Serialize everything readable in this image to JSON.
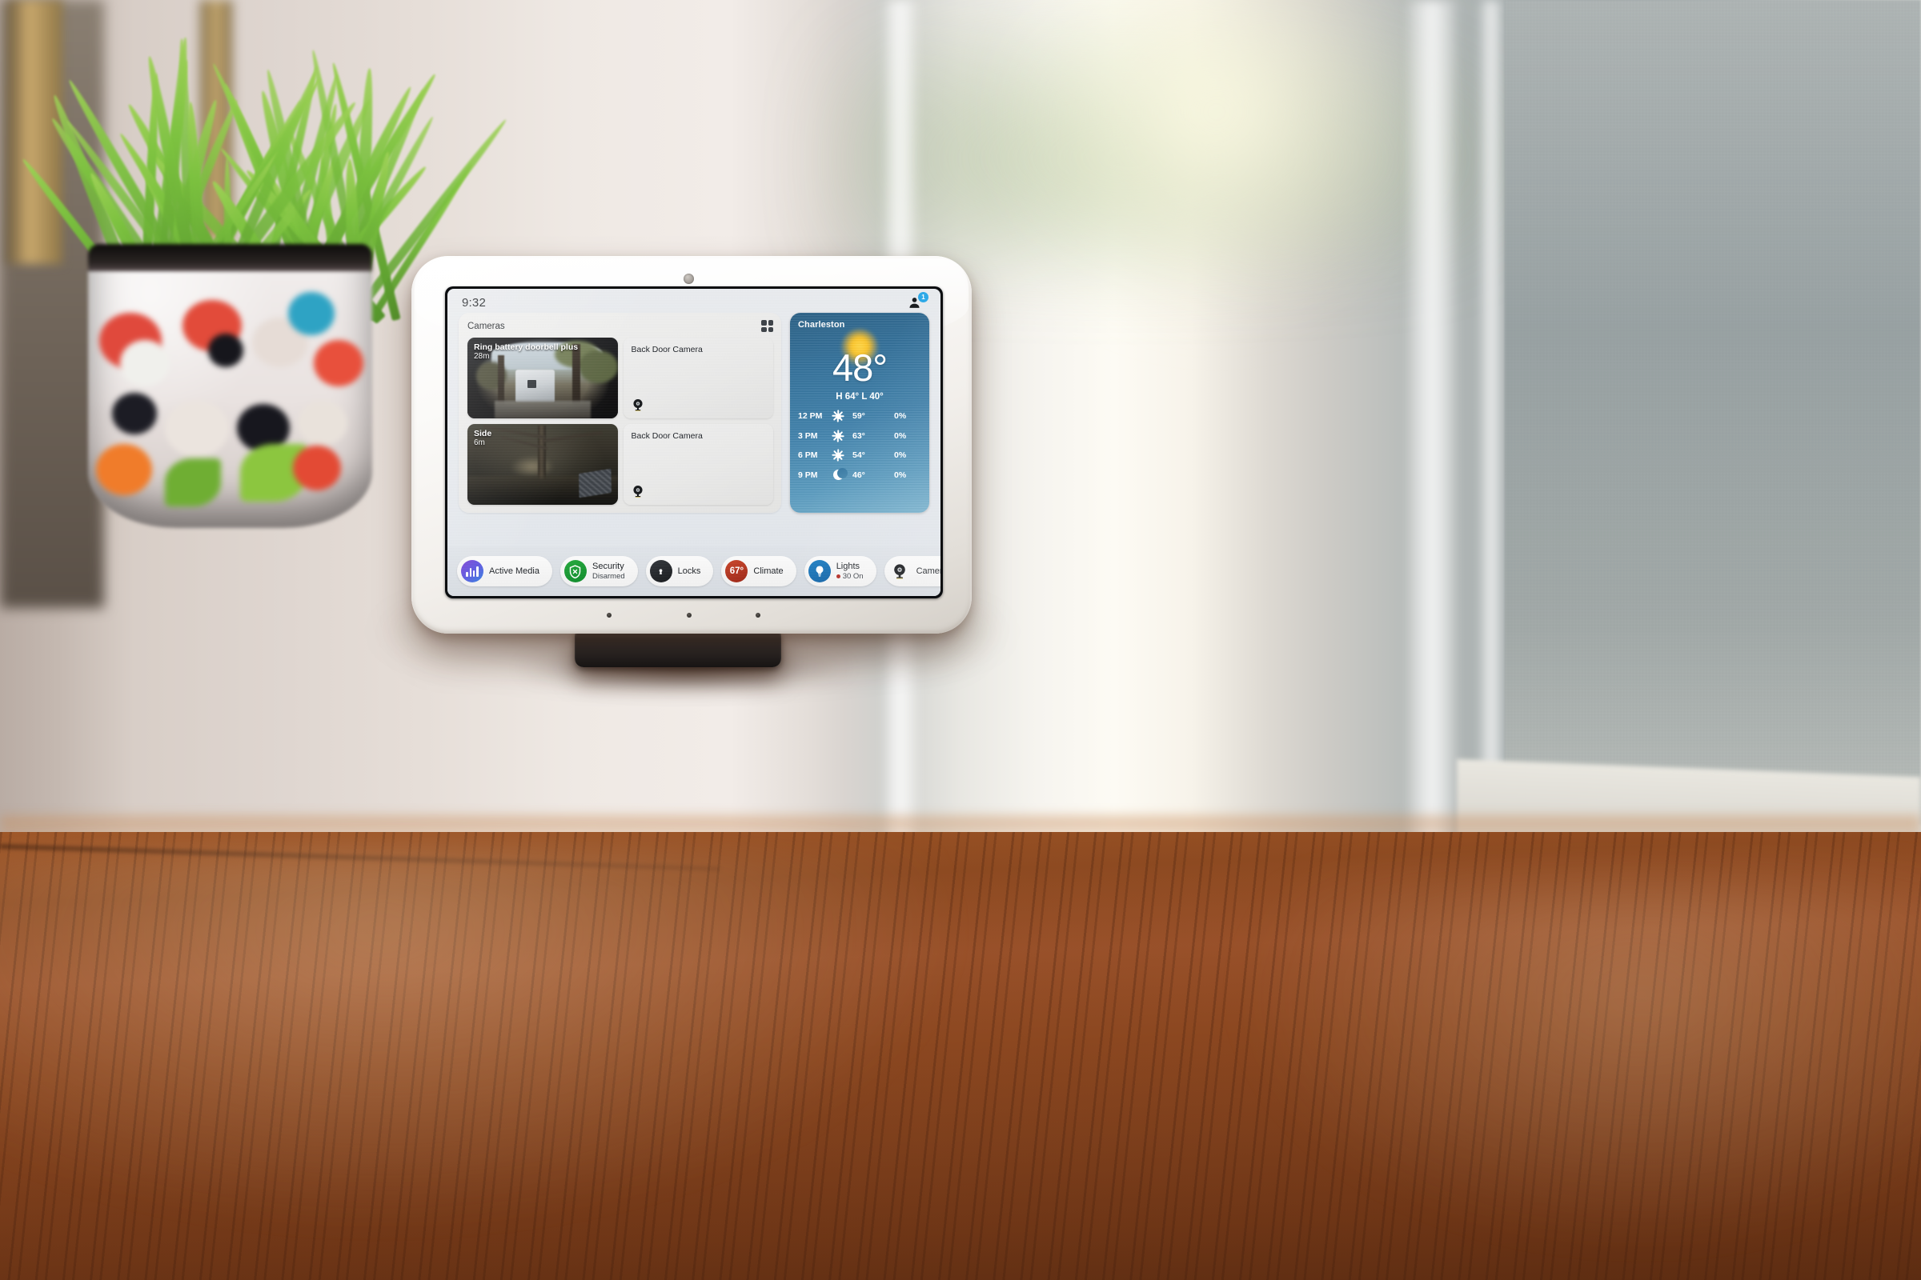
{
  "device": {
    "product_type": "smart-display",
    "camera_dot": "front-camera"
  },
  "screen": {
    "status_bar": {
      "time": "9:32",
      "account_icon": "person-icon",
      "notification_count": "1"
    },
    "cameras_panel": {
      "title": "Cameras",
      "grid_view_icon": "grid-view-icon",
      "tiles": [
        {
          "name": "Ring battery doorbell plus",
          "age": "28m",
          "kind": "live-thumbnail"
        },
        {
          "name": "Back Door Camera",
          "age": "",
          "kind": "placeholder",
          "icon": "webcam-icon"
        },
        {
          "name": "Side",
          "age": "6m",
          "kind": "live-thumbnail"
        },
        {
          "name": "Back Door Camera",
          "age": "",
          "kind": "placeholder",
          "icon": "webcam-icon"
        }
      ]
    },
    "weather": {
      "city": "Charleston",
      "condition_icon": "sun-icon",
      "temperature": "48°",
      "high_low": "H 64°  L 40°",
      "forecast": [
        {
          "time": "12 PM",
          "icon": "sun-icon",
          "temp": "59°",
          "precip": "0%"
        },
        {
          "time": "3 PM",
          "icon": "sun-icon",
          "temp": "63°",
          "precip": "0%"
        },
        {
          "time": "6 PM",
          "icon": "sun-icon",
          "temp": "54°",
          "precip": "0%"
        },
        {
          "time": "9 PM",
          "icon": "moon-icon",
          "temp": "46°",
          "precip": "0%"
        }
      ]
    },
    "chips": [
      {
        "label": "Active Media",
        "sub": "",
        "icon": "media-bars-icon",
        "color": "#6b46d6"
      },
      {
        "label": "Security",
        "sub": "Disarmed",
        "icon": "shield-x-icon",
        "color": "#18992f"
      },
      {
        "label": "Locks",
        "sub": "",
        "icon": "lock-icon",
        "color": "#23262a"
      },
      {
        "label": "Climate",
        "sub": "",
        "icon": "temp-badge-icon",
        "color": "#b13620",
        "badge_text": "67°"
      },
      {
        "label": "Lights",
        "sub": "30 On",
        "icon": "lightbulb-icon",
        "color": "#1570b4"
      },
      {
        "label": "Cameras",
        "sub": "",
        "icon": "webcam-icon",
        "color": "#1c1e22"
      }
    ]
  }
}
